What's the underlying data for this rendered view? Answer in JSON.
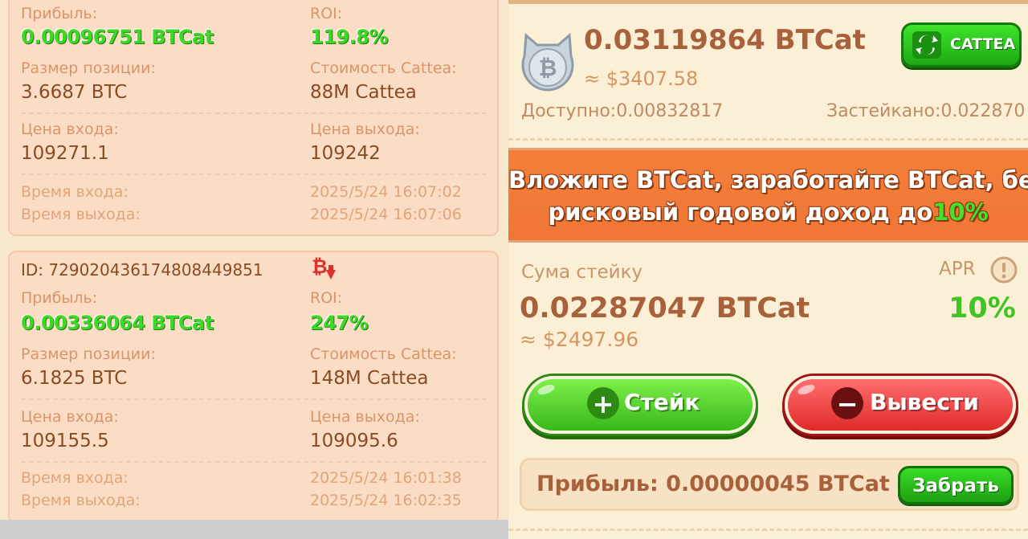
{
  "left": {
    "card1": {
      "profit_label": "Прибыль:",
      "profit_value": "0.00096751 BTCat",
      "roi_label": "ROI:",
      "roi_value": "119.8%",
      "position_size_label": "Размер позиции:",
      "position_size_value": "3.6687 BTC",
      "cattea_cost_label": "Стоимость Cattea:",
      "cattea_cost_value": "88M Cattea",
      "entry_price_label": "Цена входа:",
      "entry_price_value": "109271.1",
      "exit_price_label": "Цена выхода:",
      "exit_price_value": "109242",
      "entry_time_label": "Время входа:",
      "entry_time_value": "2025/5/24 16:07:02",
      "exit_time_label": "Время выхода:",
      "exit_time_value": "2025/5/24 16:07:06"
    },
    "card2": {
      "id_text": "ID: 729020436174808449851",
      "profit_label": "Прибыль:",
      "profit_value": "0.00336064 BTCat",
      "roi_label": "ROI:",
      "roi_value": "247%",
      "position_size_label": "Размер позиции:",
      "position_size_value": "6.1825 BTC",
      "cattea_cost_label": "Стоимость Cattea:",
      "cattea_cost_value": "148M Cattea",
      "entry_price_label": "Цена входа:",
      "entry_price_value": "109155.5",
      "exit_price_label": "Цена выхода:",
      "exit_price_value": "109095.6",
      "entry_time_label": "Время входа:",
      "entry_time_value": "2025/5/24 16:01:38",
      "exit_time_label": "Время выхода:",
      "exit_time_value": "2025/5/24 16:02:35"
    }
  },
  "right": {
    "balance": "0.03119864 BTCat",
    "balance_usd": "≈ $3407.58",
    "available": "Доступно:0.00832817",
    "staked": "Застейкано:0.022870",
    "cattea_button": "CATTEA",
    "banner_line1": "Вложите BTCat, заработайте BTCat, без",
    "banner_line2": "рисковый годовой доход до",
    "banner_pct": "10%",
    "stake_sum_label": "Сума стейку",
    "apr_label": "APR",
    "stake_amount": "0.02287047 BTCat",
    "apr_value": "10%",
    "stake_usd": "≈ $2497.96",
    "stake_button": "Стейк",
    "withdraw_button": "Вывести",
    "profit_text": "Прибыль:  0.00000045 BTCat",
    "claim_button": "Забрать"
  },
  "colors": {
    "green_accent": "#3fd82a",
    "brown_text": "#8a4b22",
    "label_text": "#d9956a",
    "banner_orange": "#f07636",
    "withdraw_red": "#e02a2a"
  },
  "icons": [
    "bitcoin-down-icon",
    "bitcoin-cat-coin-icon",
    "swap-arrows-icon",
    "info-icon",
    "plus-icon",
    "minus-icon"
  ]
}
